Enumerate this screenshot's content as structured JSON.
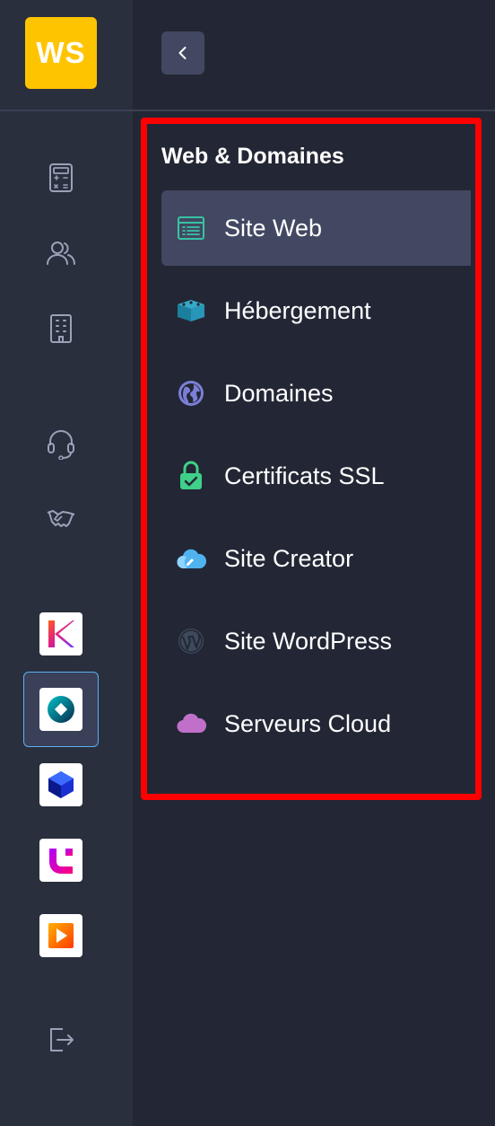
{
  "logo": {
    "text": "WS",
    "color": "#ffc400"
  },
  "header": {
    "back_icon": "chevron-left-icon"
  },
  "rail": {
    "icons": [
      {
        "name": "calculator-icon"
      },
      {
        "name": "users-icon"
      },
      {
        "name": "building-icon"
      },
      {
        "name": "headset-icon"
      },
      {
        "name": "handshake-icon"
      }
    ],
    "apps": [
      {
        "name": "app-tile-k",
        "active": false
      },
      {
        "name": "app-tile-o",
        "active": true
      },
      {
        "name": "app-tile-cube",
        "active": false
      },
      {
        "name": "app-tile-phone",
        "active": false
      },
      {
        "name": "app-tile-play",
        "active": false
      }
    ],
    "logout_icon": "logout-icon"
  },
  "section": {
    "title": "Web & Domaines",
    "items": [
      {
        "label": "Site Web",
        "icon": "browser-list-icon",
        "active": true
      },
      {
        "label": "Hébergement",
        "icon": "server-stack-icon",
        "active": false
      },
      {
        "label": "Domaines",
        "icon": "globe-icon",
        "active": false
      },
      {
        "label": "Certificats SSL",
        "icon": "lock-check-icon",
        "active": false
      },
      {
        "label": "Site Creator",
        "icon": "cloud-pencil-icon",
        "active": false
      },
      {
        "label": "Site WordPress",
        "icon": "wordpress-icon",
        "active": false
      },
      {
        "label": "Serveurs Cloud",
        "icon": "cloud-icon",
        "active": false
      }
    ]
  },
  "colors": {
    "background": "#232735",
    "rail": "#2a2f3e",
    "active_item": "#424861",
    "highlight_border": "#ff0000"
  }
}
